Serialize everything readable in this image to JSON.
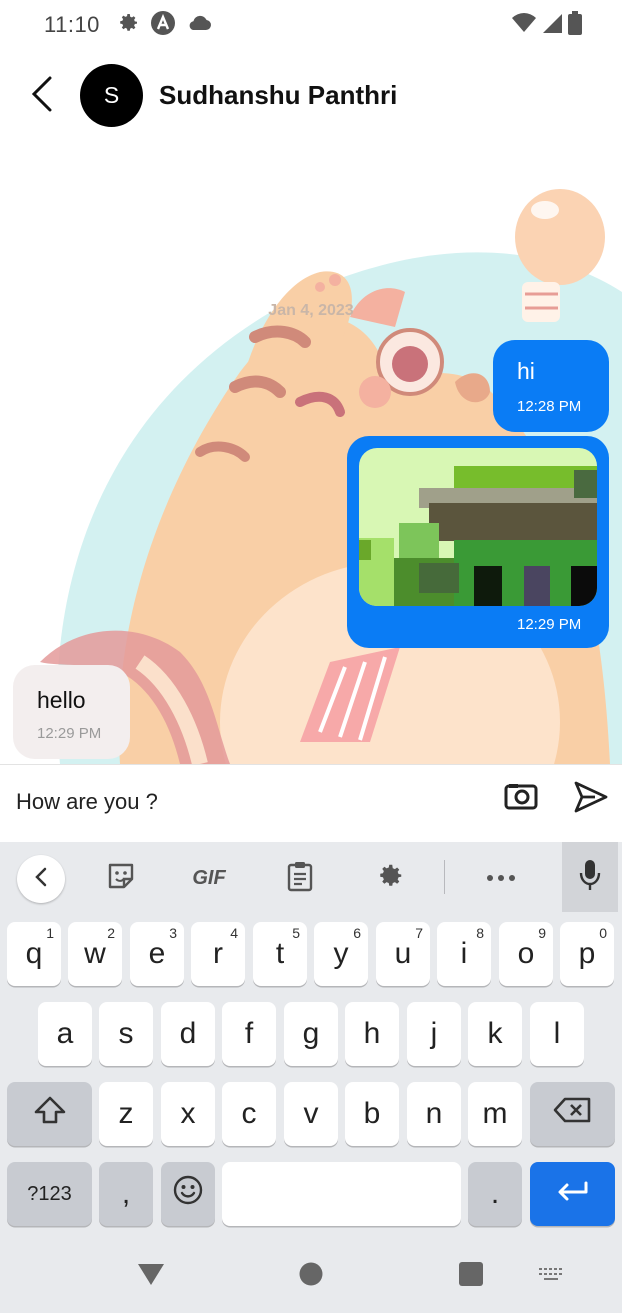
{
  "status_bar": {
    "time": "11:10",
    "left_icons": [
      "gear-icon",
      "a-icon",
      "cloud-icon"
    ],
    "right_icons": [
      "wifi-icon",
      "signal-icon",
      "battery-icon"
    ]
  },
  "header": {
    "avatar_initial": "S",
    "contact_name": "Sudhanshu Panthri"
  },
  "chat": {
    "date_separator": "Jan 4, 2023",
    "messages": [
      {
        "direction": "outgoing",
        "type": "text",
        "text": "hi",
        "time": "12:28 PM"
      },
      {
        "direction": "outgoing",
        "type": "image",
        "time": "12:29 PM"
      },
      {
        "direction": "incoming",
        "type": "text",
        "text": "hello",
        "time": "12:29 PM"
      }
    ]
  },
  "composer": {
    "input_value": "How are you ?",
    "attach_icon": "camera-card-icon",
    "send_icon": "send-icon"
  },
  "keyboard": {
    "toolbar": [
      "chevron-left-icon",
      "sticker-icon",
      "GIF",
      "clipboard-icon",
      "gear-icon",
      "more-icon",
      "mic-icon"
    ],
    "gif_label": "GIF",
    "row1": [
      {
        "k": "q",
        "h": "1"
      },
      {
        "k": "w",
        "h": "2"
      },
      {
        "k": "e",
        "h": "3"
      },
      {
        "k": "r",
        "h": "4"
      },
      {
        "k": "t",
        "h": "5"
      },
      {
        "k": "y",
        "h": "6"
      },
      {
        "k": "u",
        "h": "7"
      },
      {
        "k": "i",
        "h": "8"
      },
      {
        "k": "o",
        "h": "9"
      },
      {
        "k": "p",
        "h": "0"
      }
    ],
    "row2": [
      "a",
      "s",
      "d",
      "f",
      "g",
      "h",
      "j",
      "k",
      "l"
    ],
    "row3": [
      "z",
      "x",
      "c",
      "v",
      "b",
      "n",
      "m"
    ],
    "row4": {
      "symbols": "?123",
      "comma": ",",
      "period": "."
    },
    "accent_color": "#1a73e8"
  },
  "nav_bar": [
    "back-triangle-icon",
    "home-circle-icon",
    "recents-square-icon",
    "keyboard-switch-icon"
  ],
  "colors": {
    "outgoing_bubble": "#0a7cf5",
    "incoming_bubble": "#f3eeee"
  }
}
